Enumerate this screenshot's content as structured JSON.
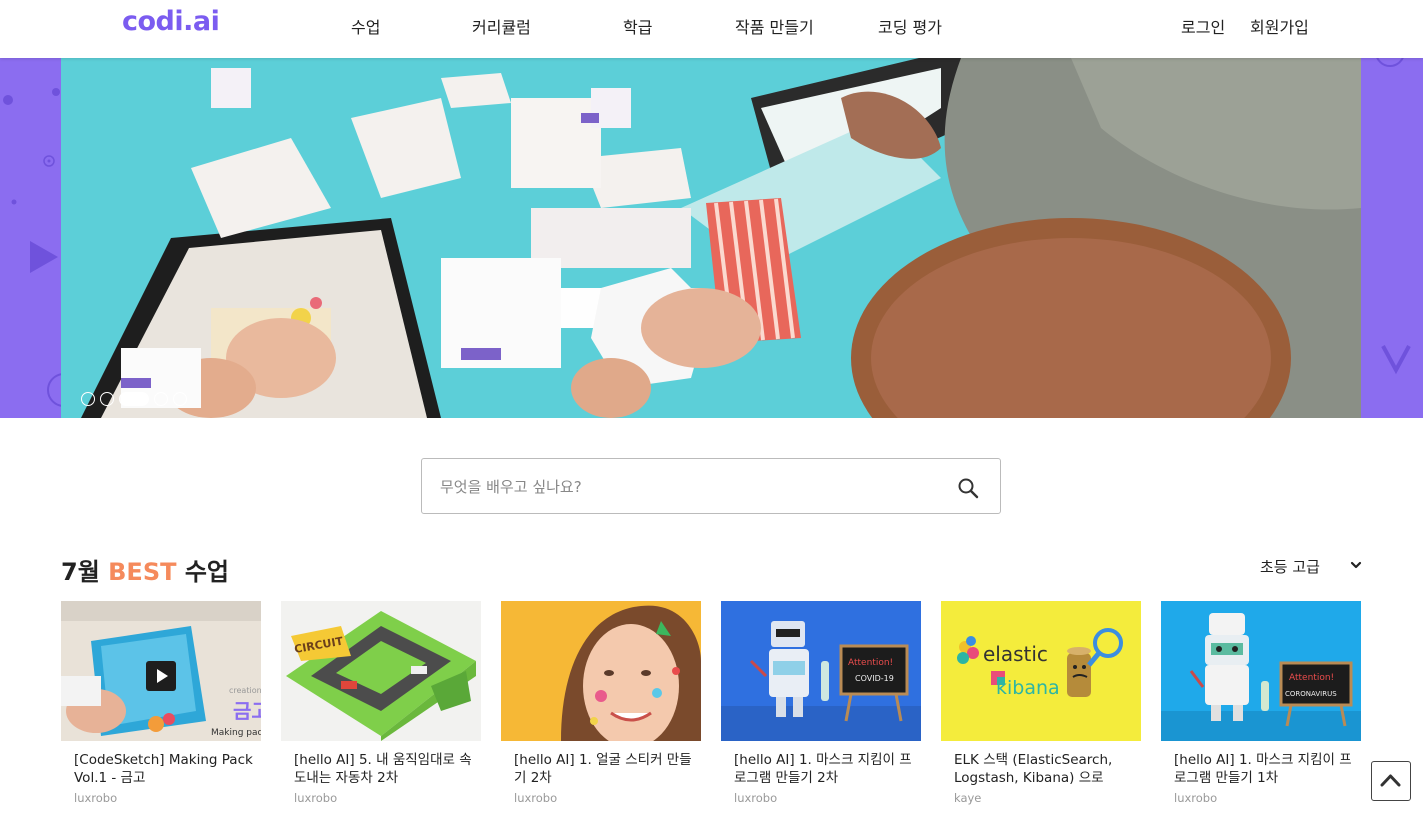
{
  "header": {
    "logo": "codi.ai",
    "nav": [
      "수업",
      "커리큘럼",
      "학급",
      "작품 만들기",
      "코딩 평가"
    ],
    "login": "로그인",
    "signup": "회원가입"
  },
  "hero": {
    "slides_total": 5,
    "active_slide": 3
  },
  "search": {
    "placeholder": "무엇을 배우고 싶나요?"
  },
  "section": {
    "title_prefix": "7월 ",
    "title_highlight": "BEST",
    "title_suffix": " 수업",
    "level_selected": "초등 고급"
  },
  "cards": [
    {
      "title": "[CodeSketch] Making Pack Vol.1 - 금고",
      "author": "luxrobo"
    },
    {
      "title": "[hello AI] 5. 내 움직임대로 속도내는 자동차 2차",
      "author": "luxrobo"
    },
    {
      "title": "[hello AI] 1. 얼굴 스티커 만들기 2차",
      "author": "luxrobo"
    },
    {
      "title": "[hello AI] 1. 마스크 지킴이 프로그램 만들기 2차",
      "author": "luxrobo"
    },
    {
      "title": "ELK 스택 (ElasticSearch, Logstash, Kibana) 으로",
      "author": "kaye"
    },
    {
      "title": "[hello AI] 1. 마스크 지킴이 프로그램 만들기 1차",
      "author": "luxrobo"
    }
  ],
  "thumb_text": {
    "card1_brand": "creation",
    "card1_label": "금고",
    "card1_pack": "Making pack",
    "card2_sign": "CIRCUIT",
    "card4_sign1": "Attention!",
    "card4_sign2": "COVID-19",
    "card5_word1": "elastic",
    "card5_word2": "kibana",
    "card6_sign1": "Attention!",
    "card6_sign2": "CORONAVIRUS"
  },
  "colors": {
    "brand": "#7b5cf0",
    "hero_bg": "#8b6df0",
    "best": "#f58a5c"
  }
}
